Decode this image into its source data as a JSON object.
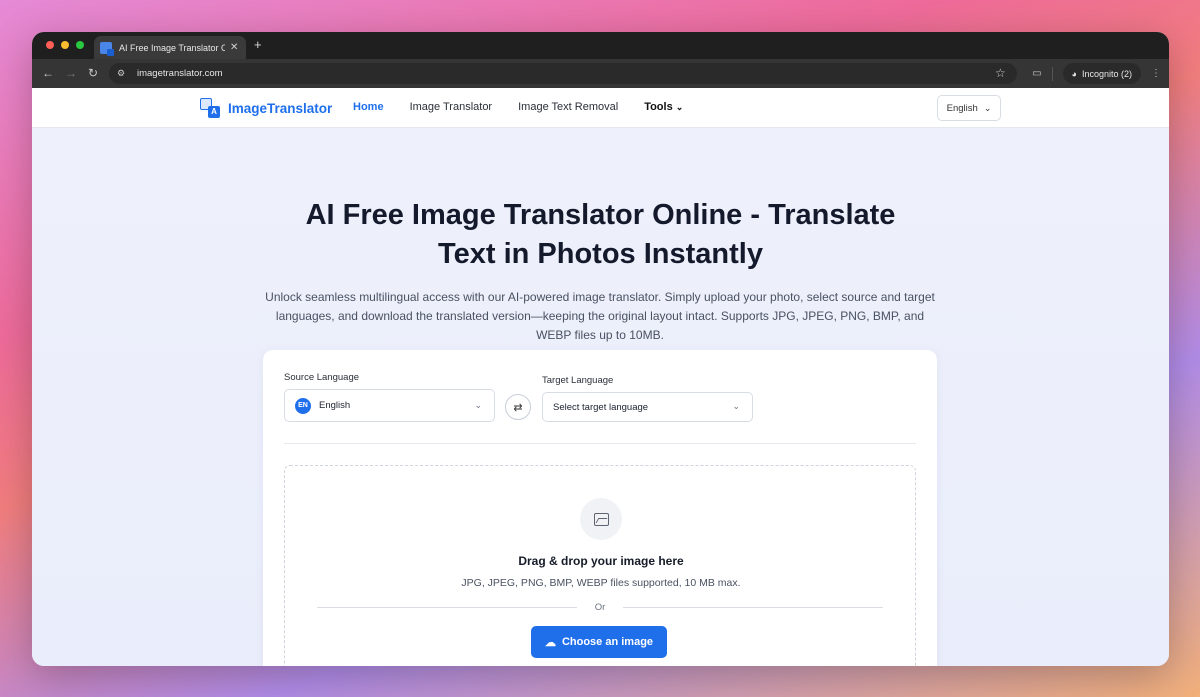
{
  "browser": {
    "tab_title": "AI Free Image Translator Onli",
    "url": "imagetranslator.com",
    "incognito_label": "Incognito (2)",
    "traffic_colors": [
      "#ff5f57",
      "#febc2e",
      "#28c840"
    ]
  },
  "nav": {
    "logo_text": "ImageTranslator",
    "links": [
      "Home",
      "Image Translator",
      "Image Text Removal",
      "Tools"
    ],
    "language_button": "English"
  },
  "hero": {
    "title_line1": "AI Free Image Translator Online - Translate",
    "title_line2": "Text in Photos Instantly",
    "description": "Unlock seamless multilingual access with our AI-powered image translator. Simply upload your photo, select source and target languages, and download the translated version—keeping the original layout intact. Supports JPG, JPEG, PNG, BMP, and WEBP files up to 10MB."
  },
  "translator": {
    "source_label": "Source Language",
    "source_value": "English",
    "source_badge": "EN",
    "target_label": "Target Language",
    "target_placeholder": "Select target language"
  },
  "upload": {
    "title": "Drag & drop your image here",
    "subtitle": "JPG, JPEG, PNG, BMP, WEBP files supported, 10 MB max.",
    "or_text": "Or",
    "button_label": "Choose an image"
  },
  "colors": {
    "accent": "#1f6feb"
  }
}
